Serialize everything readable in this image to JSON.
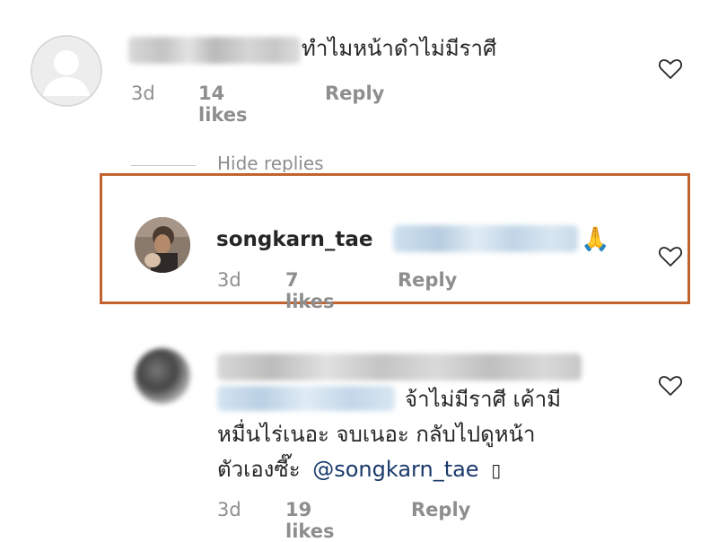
{
  "comment1": {
    "text": "ทำไมหน้าดำไม่มีราศี",
    "time": "3d",
    "likes": "14 likes",
    "reply": "Reply"
  },
  "replies_toggle": "Hide replies",
  "reply1": {
    "username": "songkarn_tae",
    "emoji": "🙏",
    "time": "3d",
    "likes": "7 likes",
    "reply": "Reply"
  },
  "reply2": {
    "line1": "จ้าไม่มีราศี เค้ามี",
    "line2": "หมื่นไร่เนอะ จบเนอะ กลับไปดูหน้า",
    "line3_prefix": "ตัวเองซี๊ะ",
    "mention": "@songkarn_tae",
    "line3_suffix": "▯",
    "time": "3d",
    "likes": "19 likes",
    "reply": "Reply"
  },
  "colors": {
    "highlight_border": "#c2632f",
    "meta_gray": "#8e8e8e",
    "text": "#262626",
    "mention": "#1a3a6b"
  },
  "icons": [
    "default-avatar-icon",
    "heart-icon",
    "folded-hands-emoji"
  ]
}
